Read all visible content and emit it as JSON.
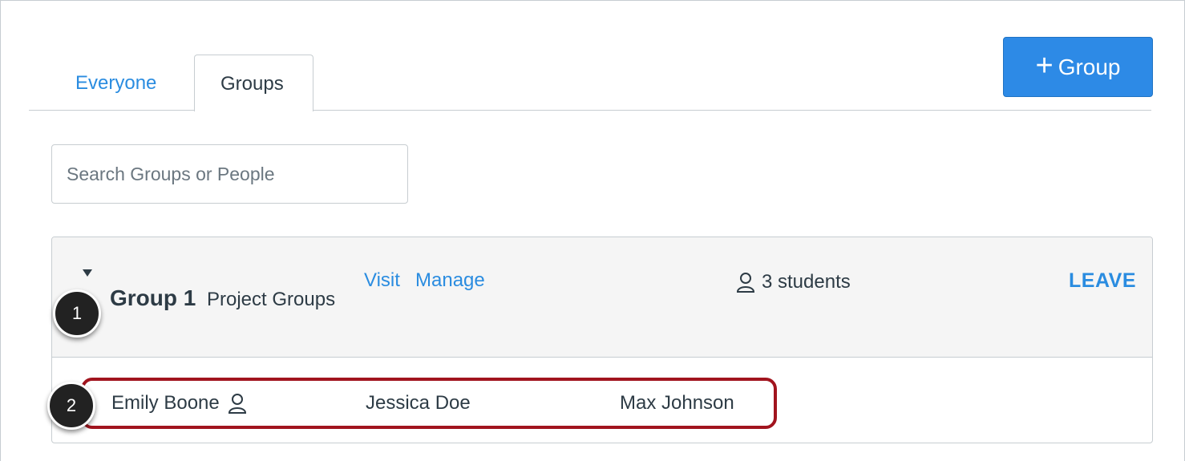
{
  "tabs": [
    {
      "label": "Everyone",
      "active": false
    },
    {
      "label": "Groups",
      "active": true
    }
  ],
  "add_group_button": {
    "icon": "plus-icon",
    "label": "Group"
  },
  "search": {
    "placeholder": "Search Groups or People",
    "value": ""
  },
  "group": {
    "name": "Group 1",
    "category": "Project Groups",
    "links": {
      "visit": "Visit",
      "manage": "Manage"
    },
    "student_count_label": "3 students",
    "leave_label": "LEAVE",
    "expanded": true,
    "members": [
      {
        "name": "Emily Boone",
        "is_leader": true
      },
      {
        "name": "Jessica Doe",
        "is_leader": false
      },
      {
        "name": "Max Johnson",
        "is_leader": false
      }
    ]
  },
  "callouts": [
    "1",
    "2"
  ],
  "colors": {
    "link": "#2a8ce0",
    "button": "#2d8ae6",
    "highlight": "#a1141e",
    "header_bg": "#f5f5f5"
  }
}
